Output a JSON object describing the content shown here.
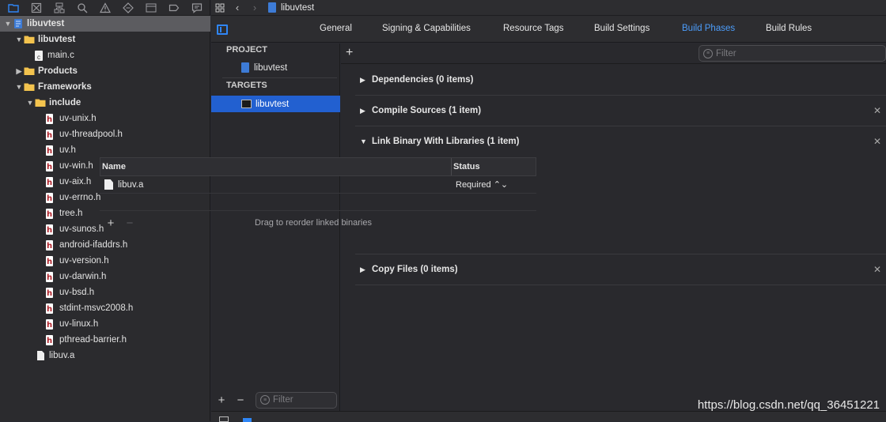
{
  "navigator": {
    "toolbar_icons": [
      "folder-icon",
      "source-control-icon",
      "hierarchy-icon",
      "search-icon",
      "warning-icon",
      "test-icon",
      "debug-icon",
      "breakpoint-icon",
      "report-icon"
    ],
    "tree": [
      {
        "label": "libuvtest",
        "depth": 0,
        "expanded": true,
        "kind": "project",
        "selected": true
      },
      {
        "label": "libuvtest",
        "depth": 1,
        "expanded": true,
        "kind": "folder",
        "bold": true
      },
      {
        "label": "main.c",
        "depth": 2,
        "kind": "c"
      },
      {
        "label": "Products",
        "depth": 1,
        "expanded": false,
        "kind": "folder",
        "bold": true
      },
      {
        "label": "Frameworks",
        "depth": 1,
        "expanded": true,
        "kind": "folder",
        "bold": true
      },
      {
        "label": "include",
        "depth": 2,
        "expanded": true,
        "kind": "folder",
        "bold": true
      },
      {
        "label": "uv-unix.h",
        "depth": 3,
        "kind": "h"
      },
      {
        "label": "uv-threadpool.h",
        "depth": 3,
        "kind": "h"
      },
      {
        "label": "uv.h",
        "depth": 3,
        "kind": "h"
      },
      {
        "label": "uv-win.h",
        "depth": 3,
        "kind": "h"
      },
      {
        "label": "uv-aix.h",
        "depth": 3,
        "kind": "h"
      },
      {
        "label": "uv-errno.h",
        "depth": 3,
        "kind": "h"
      },
      {
        "label": "tree.h",
        "depth": 3,
        "kind": "h"
      },
      {
        "label": "uv-sunos.h",
        "depth": 3,
        "kind": "h"
      },
      {
        "label": "android-ifaddrs.h",
        "depth": 3,
        "kind": "h"
      },
      {
        "label": "uv-version.h",
        "depth": 3,
        "kind": "h"
      },
      {
        "label": "uv-darwin.h",
        "depth": 3,
        "kind": "h"
      },
      {
        "label": "uv-bsd.h",
        "depth": 3,
        "kind": "h"
      },
      {
        "label": "stdint-msvc2008.h",
        "depth": 3,
        "kind": "h"
      },
      {
        "label": "uv-linux.h",
        "depth": 3,
        "kind": "h"
      },
      {
        "label": "pthread-barrier.h",
        "depth": 3,
        "kind": "h"
      },
      {
        "label": "libuv.a",
        "depth": 2,
        "kind": "lib"
      }
    ]
  },
  "topbar": {
    "breadcrumb": "libuvtest"
  },
  "tabs": [
    {
      "label": "General",
      "active": false
    },
    {
      "label": "Signing & Capabilities",
      "active": false
    },
    {
      "label": "Resource Tags",
      "active": false
    },
    {
      "label": "Build Settings",
      "active": false
    },
    {
      "label": "Build Phases",
      "active": true
    },
    {
      "label": "Build Rules",
      "active": false
    }
  ],
  "targets_panel": {
    "project_header": "PROJECT",
    "project_item": "libuvtest",
    "targets_header": "TARGETS",
    "target_item": "libuvtest",
    "filter_placeholder": "Filter",
    "add_label": "+",
    "remove_label": "−"
  },
  "phases": {
    "filter_placeholder": "Filter",
    "add_label": "+",
    "items": [
      {
        "title": "Dependencies (0 items)",
        "expanded": false,
        "removable": false
      },
      {
        "title": "Compile Sources (1 item)",
        "expanded": false,
        "removable": true
      },
      {
        "title": "Link Binary With Libraries (1 item)",
        "expanded": true,
        "removable": true
      },
      {
        "title": "Copy Files (0 items)",
        "expanded": false,
        "removable": true
      }
    ],
    "link_table": {
      "col_name": "Name",
      "col_status": "Status",
      "rows": [
        {
          "name": "libuv.a",
          "status": "Required ⌃⌄"
        }
      ],
      "hint": "Drag to reorder linked binaries",
      "add_label": "+",
      "remove_label": "−"
    }
  },
  "watermark": "https://blog.csdn.net/qq_36451221",
  "colors": {
    "accent": "#2f86f6",
    "active_tab": "#4c9dfb",
    "selection": "#2260d0",
    "header_icon": "#b0232b"
  }
}
